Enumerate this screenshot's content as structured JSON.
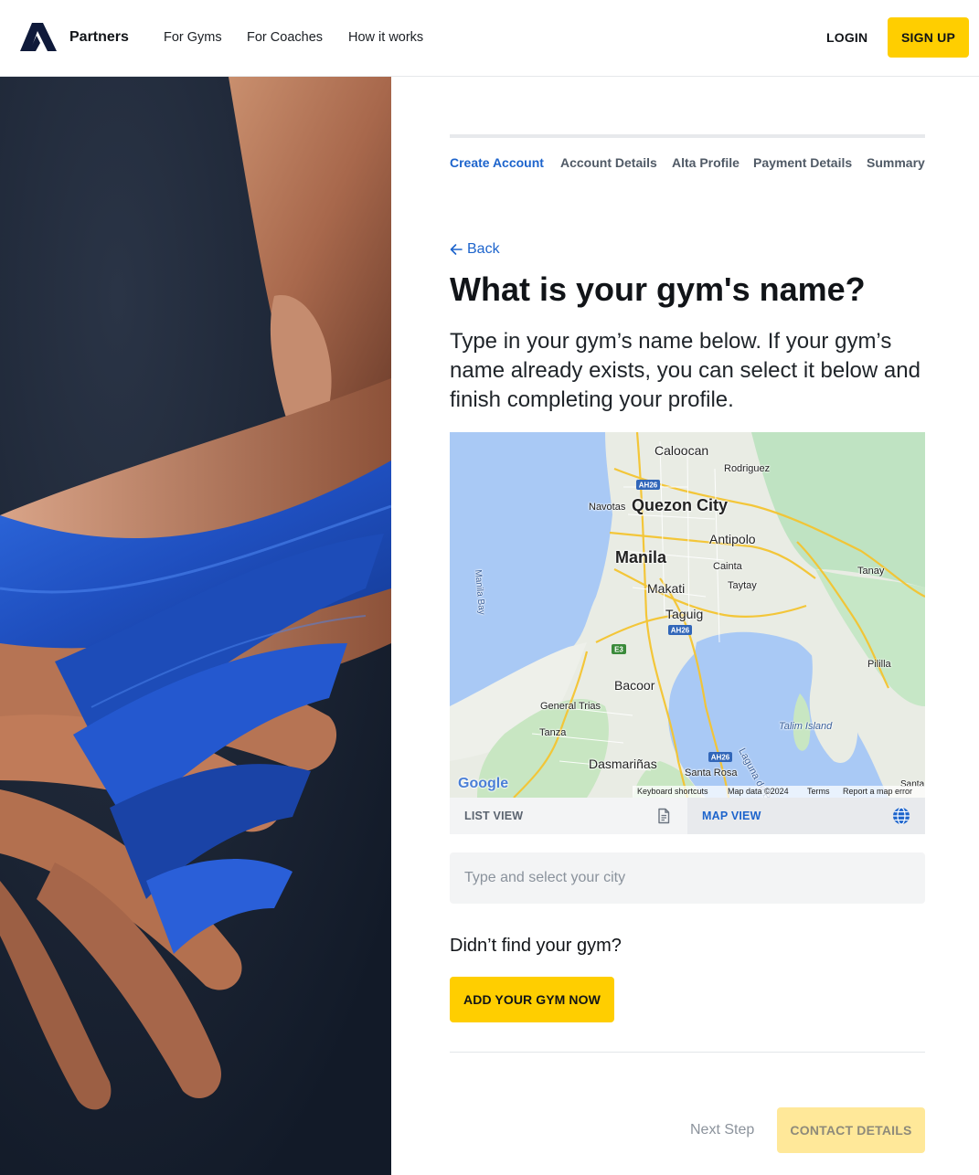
{
  "header": {
    "brand": "Partners",
    "nav": [
      "For Gyms",
      "For Coaches",
      "How it works"
    ],
    "login": "LOGIN",
    "signup": "SIGN UP"
  },
  "steps": [
    "Create Account",
    "Account Details",
    "Alta Profile",
    "Payment Details",
    "Summary"
  ],
  "active_step": "Create Account",
  "form": {
    "back": "Back",
    "title": "What is your gym's name?",
    "subtitle": "Type in your gym’s name below. If your gym’s name already exists, you can select it below and finish completing your profile.",
    "city_placeholder": "Type and select your city",
    "not_found": "Didn’t find your gym?",
    "add_gym": "ADD YOUR GYM NOW",
    "next_label": "Next Step",
    "next_button": "CONTACT DETAILS"
  },
  "map": {
    "places": [
      "Caloocan",
      "Rodriguez",
      "Navotas",
      "Quezon City",
      "Antipolo",
      "Manila",
      "Cainta",
      "Tanay",
      "Taytay",
      "Makati",
      "Taguig",
      "Bacoor",
      "General Trias",
      "Tanza",
      "Dasmariñas",
      "Santa Rosa",
      "Pililla",
      "Talim Island",
      "Laguna de B",
      "Manila Bay",
      "Santa"
    ],
    "shields": [
      "AH26",
      "AH26",
      "E3",
      "AH26"
    ],
    "provider": "Google",
    "footer": [
      "Keyboard shortcuts",
      "Map data ©2024",
      "Terms",
      "Report a map error"
    ]
  },
  "view_toggle": {
    "list": "LIST VIEW",
    "map": "MAP VIEW",
    "active": "MAP VIEW"
  },
  "icons": {
    "list": "document-icon",
    "map": "globe-icon",
    "back": "arrow-left-icon"
  },
  "colors": {
    "accent_yellow": "#ffce00",
    "link_blue": "#1d64cc",
    "water": "#a9c9f5",
    "land": "#e8ece4",
    "park": "#bfe3c2"
  }
}
